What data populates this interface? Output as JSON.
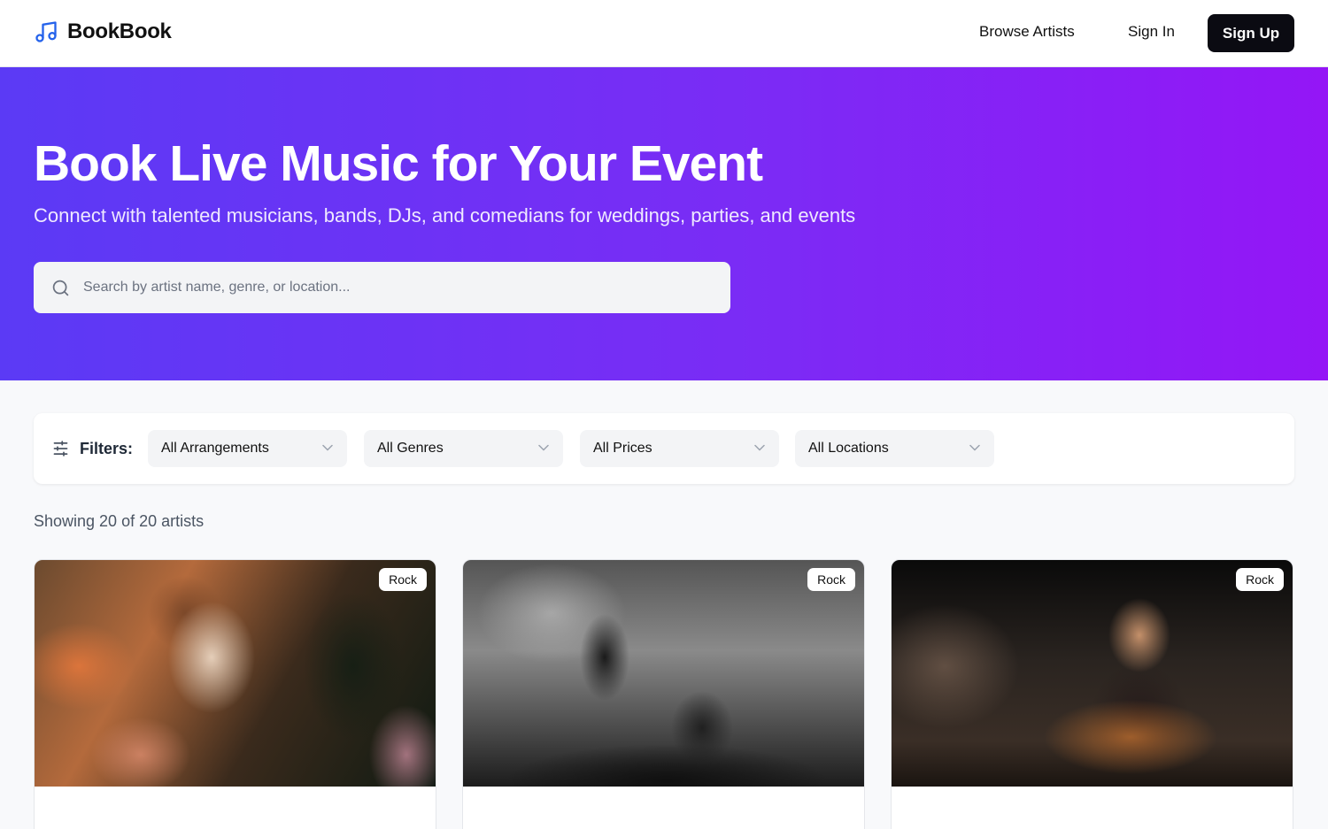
{
  "brand": {
    "name": "BookBook"
  },
  "nav": {
    "browse": "Browse Artists",
    "signin": "Sign In",
    "signup": "Sign Up"
  },
  "hero": {
    "title": "Book Live Music for Your Event",
    "subtitle": "Connect with talented musicians, bands, DJs, and comedians for weddings, parties, and events",
    "search_placeholder": "Search by artist name, genre, or location..."
  },
  "filters": {
    "label": "Filters:",
    "arrangement": "All Arrangements",
    "genre": "All Genres",
    "price": "All Prices",
    "location": "All Locations"
  },
  "results": {
    "showing": "Showing 20 of 20 artists"
  },
  "cards": [
    {
      "genre": "Rock"
    },
    {
      "genre": "Rock"
    },
    {
      "genre": "Rock"
    }
  ],
  "colors": {
    "accent_start": "#5b3af5",
    "accent_end": "#9416f6",
    "logo_blue": "#2563eb",
    "dark_button": "#0b0b12"
  },
  "icons": {
    "logo": "music-note-icon",
    "search": "search-icon",
    "filters": "sliders-icon",
    "dropdown": "chevron-down-icon"
  }
}
